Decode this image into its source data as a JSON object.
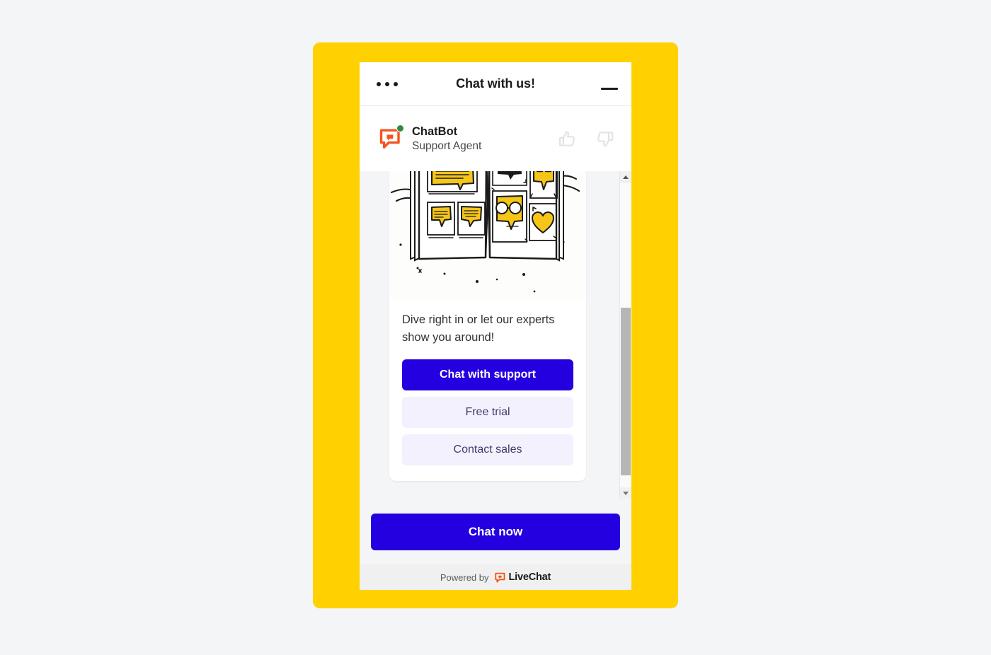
{
  "widget": {
    "titlebar": {
      "menu_icon": "ellipsis-icon",
      "title": "Chat with us!",
      "minimize_icon": "minimize-icon"
    },
    "agent": {
      "avatar_icon": "chatbot-logo-icon",
      "status": "online",
      "status_color": "#2e8b45",
      "name": "ChatBot",
      "role": "Support Agent",
      "thumbs_up_icon": "thumbs-up-icon",
      "thumbs_down_icon": "thumbs-down-icon"
    },
    "card": {
      "illustration_name": "open-book-speech-bubbles-illustration",
      "text": "Dive right in or let our experts show you around!",
      "buttons": [
        {
          "label": "Chat with support",
          "style": "primary"
        },
        {
          "label": "Free trial",
          "style": "secondary"
        },
        {
          "label": "Contact sales",
          "style": "secondary"
        }
      ]
    },
    "scrollbar": {
      "up_arrow_icon": "scroll-up-arrow-icon",
      "down_arrow_icon": "scroll-down-arrow-icon",
      "thumb_name": "scrollbar-thumb"
    },
    "footer": {
      "chat_now_label": "Chat now",
      "powered_by_label": "Powered by",
      "brand_name": "LiveChat",
      "brand_icon": "livechat-logo-icon"
    }
  },
  "colors": {
    "frame_yellow": "#ffd100",
    "primary_blue": "#2400e0",
    "secondary_lavender": "#f3f1fe",
    "secondary_text": "#3f3c6b",
    "brand_orange": "#ff5100",
    "illustration_yellow": "#f5c518",
    "online_green": "#2e8b45",
    "page_background": "#f4f5f7"
  }
}
